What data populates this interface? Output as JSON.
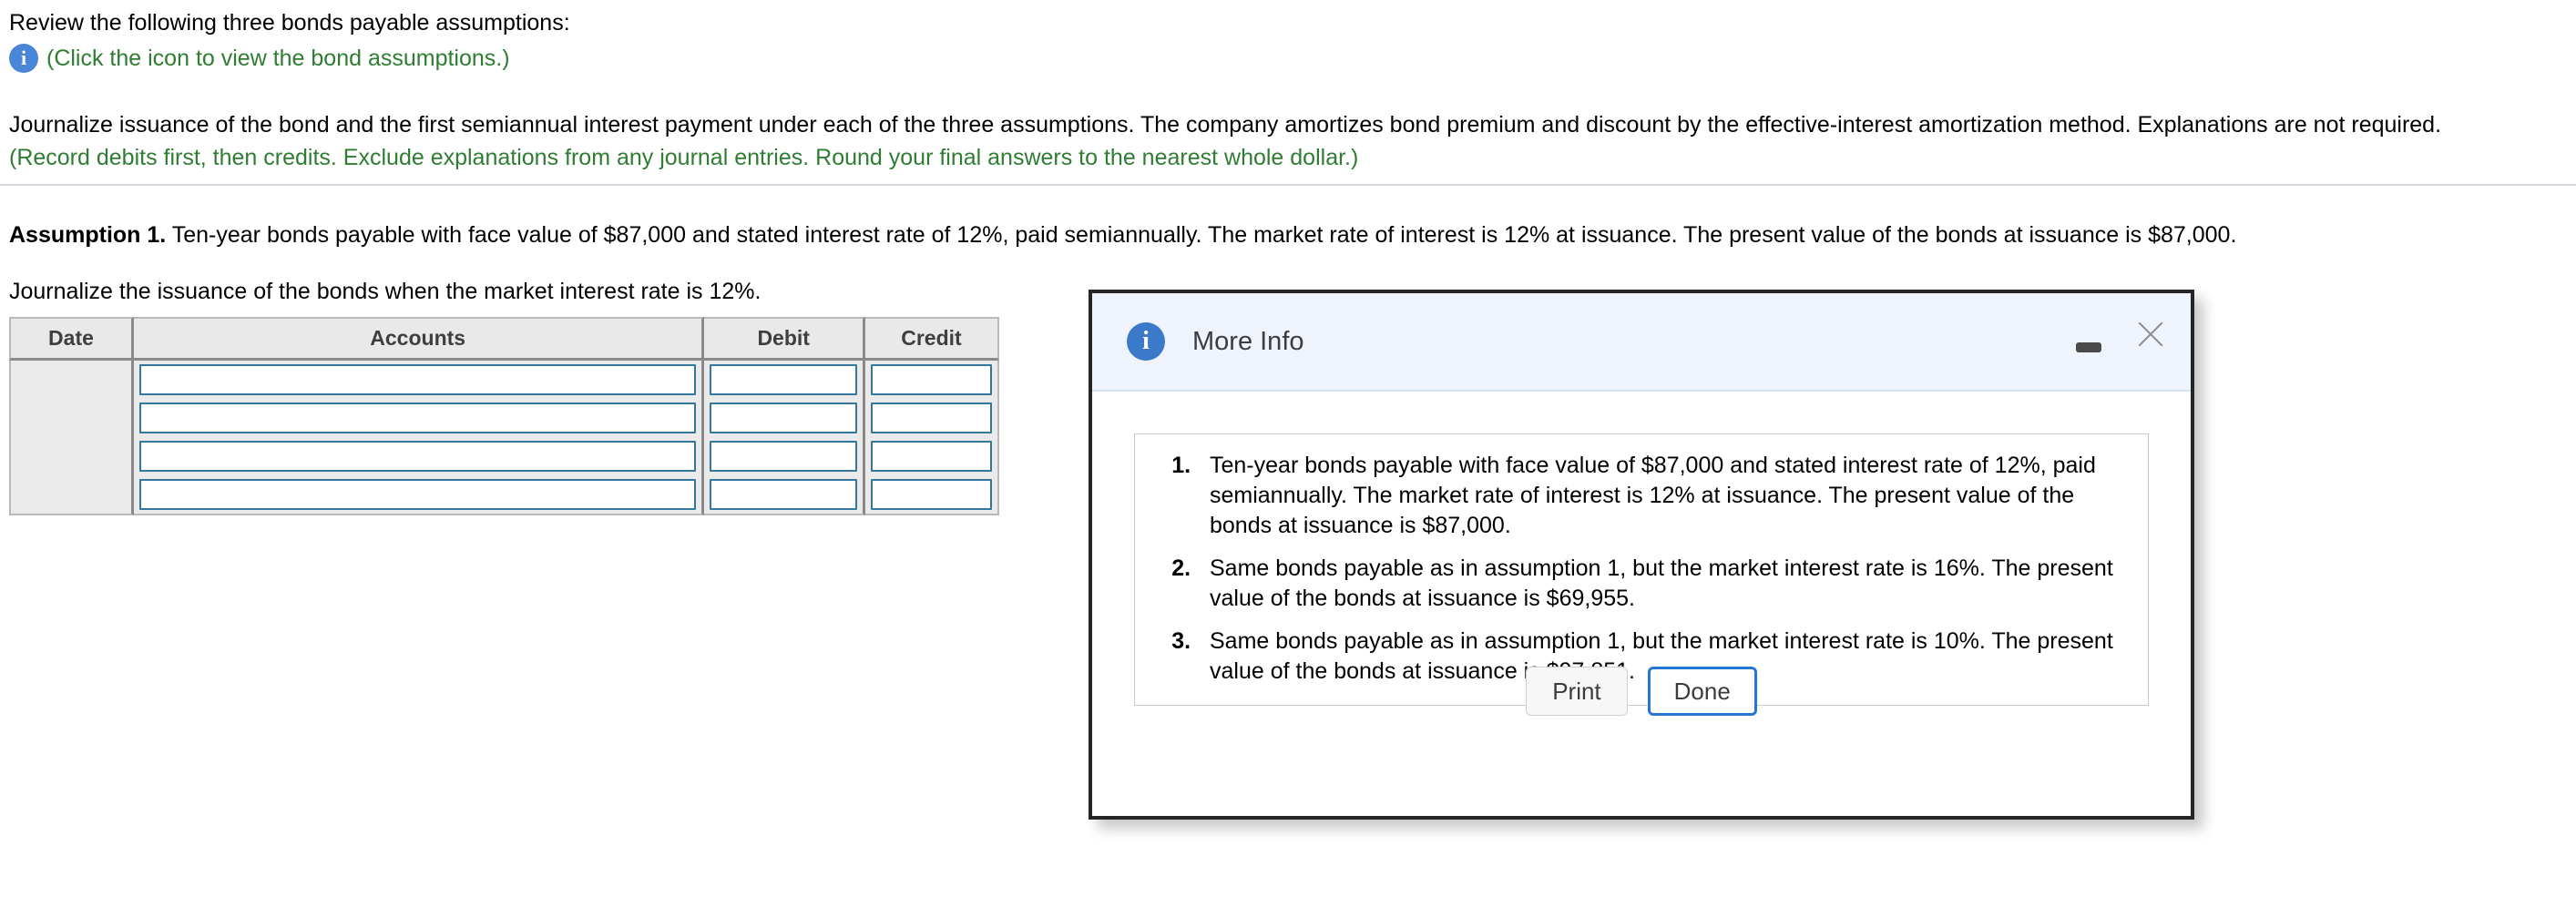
{
  "page": {
    "intro_title": "Review the following three bonds payable assumptions:",
    "icon_hint": "(Click the icon to view the bond assumptions.)",
    "info_icon_glyph": "i",
    "journalize_paragraph": "Journalize issuance of the bond and the first semiannual interest payment under each of the three assumptions. The company amortizes bond premium and discount by the effective-interest amortization method. Explanations are not required.",
    "record_note": "(Record debits first, then credits. Exclude explanations from any journal entries. Round your final answers to the nearest whole dollar.)",
    "assumption_label": "Assumption 1.",
    "assumption_text": " Ten-year bonds payable with face value of $87,000 and stated interest rate of 12%, paid semiannually. The market rate of interest is 12% at issuance. The present value of the bonds at issuance is $87,000.",
    "journalize_sub": "Journalize the issuance of the bonds when the market interest rate is 12%."
  },
  "journal_table": {
    "columns": [
      "Date",
      "Accounts",
      "Debit",
      "Credit"
    ],
    "rows": [
      {
        "date": "",
        "accounts": "",
        "debit": "",
        "credit": ""
      },
      {
        "date": "",
        "accounts": "",
        "debit": "",
        "credit": ""
      },
      {
        "date": "",
        "accounts": "",
        "debit": "",
        "credit": ""
      },
      {
        "date": "",
        "accounts": "",
        "debit": "",
        "credit": ""
      }
    ]
  },
  "dialog": {
    "title": "More Info",
    "info_icon_glyph": "i",
    "assumptions": [
      "Ten-year bonds payable with face value of $87,000 and stated interest rate of 12%, paid semiannually. The market rate of interest is 12% at issuance. The present value of the bonds at issuance is $87,000.",
      "Same bonds payable as in assumption 1, but the market interest rate is 16%. The present value of the bonds at issuance is $69,955.",
      "Same bonds payable as in assumption 1, but the market interest rate is 10%. The present value of the bonds at issuance is $97,851."
    ],
    "print_label": "Print",
    "done_label": "Done"
  },
  "colors": {
    "link_green": "#2e7d32",
    "info_blue": "#3b79c9",
    "input_border": "#33779b",
    "primary_button": "#2477d4"
  }
}
